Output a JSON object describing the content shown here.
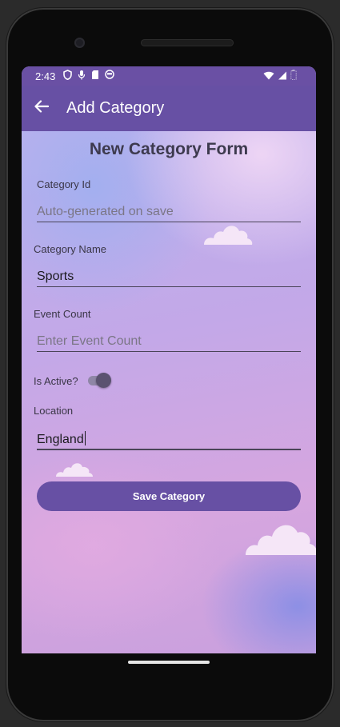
{
  "status_bar": {
    "time": "2:43",
    "icons": [
      "shield-icon",
      "mic-icon",
      "sd-card-icon",
      "face-icon"
    ],
    "right_icons": [
      "wifi-icon",
      "signal-icon",
      "battery-icon"
    ]
  },
  "app_bar": {
    "back_icon": "arrow-left-icon",
    "title": "Add Category"
  },
  "form": {
    "title": "New Category Form",
    "category_id": {
      "label": "Category Id",
      "placeholder": "Auto-generated on save",
      "value": ""
    },
    "category_name": {
      "label": "Category Name",
      "value": "Sports"
    },
    "event_count": {
      "label": "Event Count",
      "placeholder": "Enter Event Count",
      "value": ""
    },
    "is_active": {
      "label": "Is Active?",
      "checked": false
    },
    "location": {
      "label": "Location",
      "value": "England"
    },
    "save_label": "Save Category"
  },
  "colors": {
    "primary": "#6750a4",
    "status_bar": "#6a50a4",
    "title_text": "#3d3a4e",
    "cloud": "#f5e6f7"
  }
}
